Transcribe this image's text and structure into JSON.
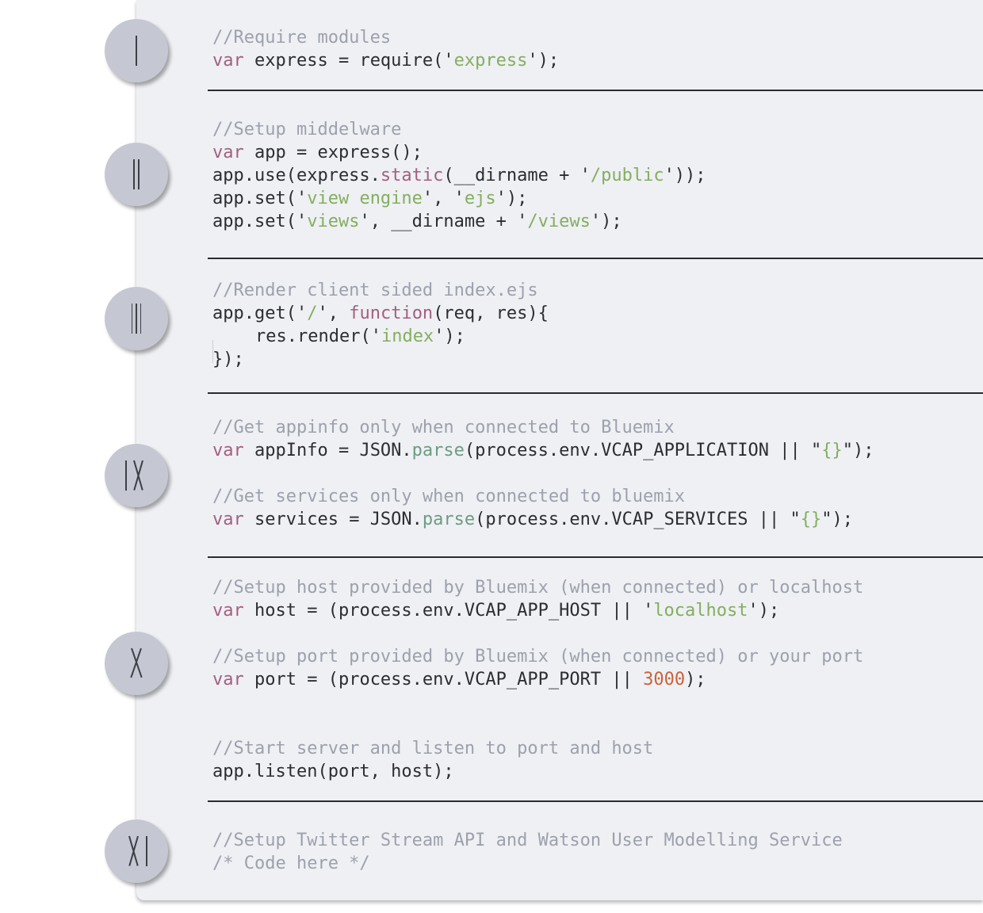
{
  "badges": [
    {
      "numeral": "I"
    },
    {
      "numeral": "II"
    },
    {
      "numeral": "III"
    },
    {
      "numeral": "IV"
    },
    {
      "numeral": "V"
    },
    {
      "numeral": "VI"
    }
  ],
  "code": {
    "s1": {
      "l1": {
        "comment": "//Require modules"
      },
      "l2": {
        "kw": "var",
        "t1": " express = require('",
        "str": "express",
        "t2": "');"
      }
    },
    "s2": {
      "l1": {
        "comment": "//Setup middelware"
      },
      "l2": {
        "kw": "var",
        "t1": " app = express();"
      },
      "l3": {
        "t1": "app.use(express.",
        "kw": "static",
        "t2": "(__dirname + '",
        "str": "/public",
        "t3": "'));"
      },
      "l4": {
        "t1": "app.set('",
        "str1": "view engine",
        "t2": "', '",
        "str2": "ejs",
        "t3": "');"
      },
      "l5": {
        "t1": "app.set('",
        "str1": "views",
        "t2": "', __dirname + '",
        "str2": "/views",
        "t3": "');"
      }
    },
    "s3": {
      "l1": {
        "comment": "//Render client sided index.ejs"
      },
      "l2": {
        "t1": "app.get('",
        "str": "/",
        "t2": "', ",
        "kw": "function",
        "t3": "(req, res){"
      },
      "l3": {
        "t1": "res.render('",
        "str": "index",
        "t2": "');"
      },
      "l4": {
        "t1": "});"
      }
    },
    "s4": {
      "l1": {
        "comment": "//Get appinfo only when connected to Bluemix"
      },
      "l2": {
        "kw": "var",
        "t1": " appInfo = JSON.",
        "fn": "parse",
        "t2": "(process.env.VCAP_APPLICATION || \"",
        "str": "{}",
        "t3": "\");"
      },
      "l3": {
        "comment": "//Get services only when connected to bluemix"
      },
      "l4": {
        "kw": "var",
        "t1": " services = JSON.",
        "fn": "parse",
        "t2": "(process.env.VCAP_SERVICES || \"",
        "str": "{}",
        "t3": "\");"
      }
    },
    "s5": {
      "l1": {
        "comment": "//Setup host provided by Bluemix (when connected) or localhost"
      },
      "l2": {
        "kw": "var",
        "t1": " host = (process.env.VCAP_APP_HOST || '",
        "str": "localhost",
        "t2": "');"
      },
      "l3": {
        "comment": "//Setup port provided by Bluemix (when connected) or your port"
      },
      "l4": {
        "kw": "var",
        "t1": " port = (process.env.VCAP_APP_PORT || ",
        "num": "3000",
        "t2": ");"
      },
      "l5": {
        "comment": "//Start server and listen to port and host"
      },
      "l6": {
        "t1": "app.listen(port, host);"
      }
    },
    "s6": {
      "l1": {
        "comment": "//Setup Twitter Stream API and Watson User Modelling Service"
      },
      "l2": {
        "comment": "/* Code here */"
      }
    }
  }
}
